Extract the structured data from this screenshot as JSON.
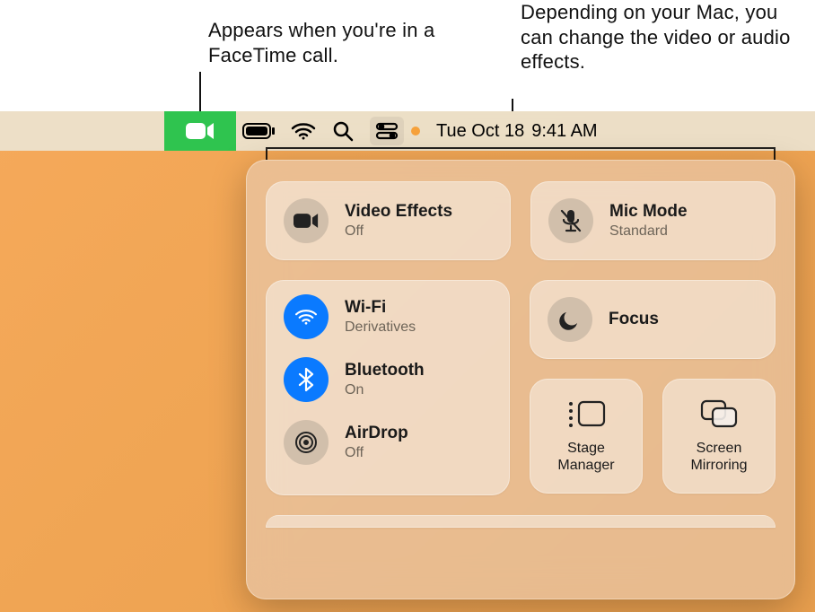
{
  "annotations": {
    "facetime": "Appears when you're in a FaceTime call.",
    "effects": "Depending on your Mac, you can change the video or audio effects."
  },
  "menubar": {
    "date": "Tue Oct 18",
    "time": "9:41 AM"
  },
  "control_center": {
    "video_effects": {
      "title": "Video Effects",
      "status": "Off"
    },
    "mic_mode": {
      "title": "Mic Mode",
      "status": "Standard"
    },
    "wifi": {
      "title": "Wi-Fi",
      "status": "Derivatives"
    },
    "bluetooth": {
      "title": "Bluetooth",
      "status": "On"
    },
    "airdrop": {
      "title": "AirDrop",
      "status": "Off"
    },
    "focus": {
      "title": "Focus"
    },
    "stage_manager": {
      "title": "Stage Manager"
    },
    "screen_mirroring": {
      "title": "Screen Mirroring"
    }
  }
}
